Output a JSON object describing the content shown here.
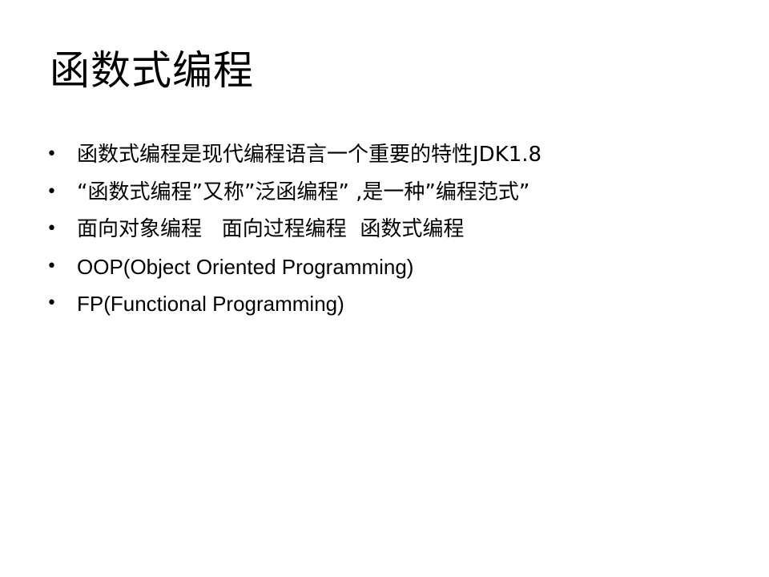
{
  "slide": {
    "title": "函数式编程",
    "bullet_glyph": "•",
    "bullets": [
      {
        "text": "函数式编程是现代编程语言一个重要的特性JDK1.8"
      },
      {
        "text": "“函数式编程”又称”泛函编程” ,是一种”编程范式”"
      },
      {
        "text": "面向对象编程   面向过程编程  函数式编程"
      },
      {
        "text": "OOP(Object Oriented Programming)"
      },
      {
        "text": "FP(Functional Programming)"
      }
    ]
  }
}
